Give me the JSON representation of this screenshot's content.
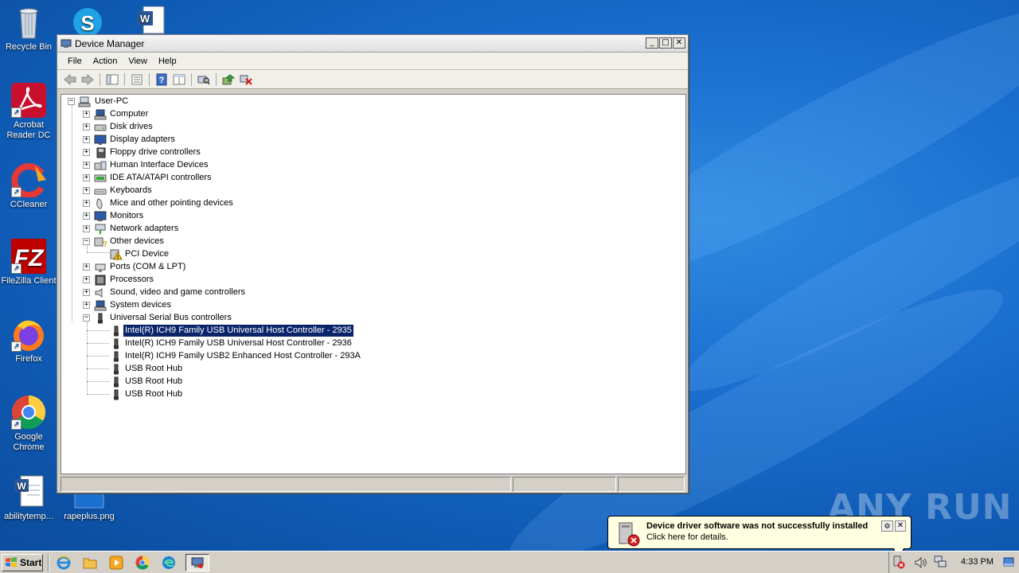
{
  "desktop": {
    "icons": [
      {
        "label": "Recycle Bin",
        "icon": "recycle-bin-icon"
      },
      {
        "label": "Acrobat Reader DC",
        "icon": "acrobat-icon"
      },
      {
        "label": "CCleaner",
        "icon": "ccleaner-icon"
      },
      {
        "label": "FileZilla Client",
        "icon": "filezilla-icon"
      },
      {
        "label": "Firefox",
        "icon": "firefox-icon"
      },
      {
        "label": "Google Chrome",
        "icon": "chrome-icon"
      },
      {
        "label": "abilitytemp...",
        "icon": "word-doc-icon"
      },
      {
        "label": "rapeplus.png",
        "icon": "image-file-icon"
      }
    ],
    "watermark": "ANY RUN"
  },
  "window": {
    "title": "Device Manager",
    "controls": {
      "minimize": "_",
      "maximize": "□",
      "close": "✕"
    },
    "menu": [
      "File",
      "Action",
      "View",
      "Help"
    ],
    "toolbar": [
      "back-icon",
      "forward-icon",
      "show-hide-console-tree-icon",
      "properties-icon",
      "help-icon",
      "action-pane-icon",
      "scan-hardware-icon",
      "update-driver-icon",
      "uninstall-icon"
    ]
  },
  "tree": {
    "root": "User-PC",
    "categories": [
      {
        "label": "Computer",
        "expanded": false
      },
      {
        "label": "Disk drives",
        "expanded": false
      },
      {
        "label": "Display adapters",
        "expanded": false
      },
      {
        "label": "Floppy drive controllers",
        "expanded": false
      },
      {
        "label": "Human Interface Devices",
        "expanded": false
      },
      {
        "label": "IDE ATA/ATAPI controllers",
        "expanded": false
      },
      {
        "label": "Keyboards",
        "expanded": false
      },
      {
        "label": "Mice and other pointing devices",
        "expanded": false
      },
      {
        "label": "Monitors",
        "expanded": false
      },
      {
        "label": "Network adapters",
        "expanded": false
      },
      {
        "label": "Other devices",
        "expanded": true,
        "children": [
          "PCI Device"
        ]
      },
      {
        "label": "Ports (COM & LPT)",
        "expanded": false
      },
      {
        "label": "Processors",
        "expanded": false
      },
      {
        "label": "Sound, video and game controllers",
        "expanded": false
      },
      {
        "label": "System devices",
        "expanded": false
      },
      {
        "label": "Universal Serial Bus controllers",
        "expanded": true,
        "children": [
          "Intel(R) ICH9 Family USB Universal Host Controller - 2935",
          "Intel(R) ICH9 Family USB Universal Host Controller - 2936",
          "Intel(R) ICH9 Family USB2 Enhanced Host Controller - 293A",
          "USB Root Hub",
          "USB Root Hub",
          "USB Root Hub"
        ]
      }
    ],
    "expand_symbol": "+",
    "collapse_symbol": "−",
    "selected": "Intel(R) ICH9 Family USB Universal Host Controller - 2935"
  },
  "balloon": {
    "title": "Device driver software was not successfully installed",
    "text": "Click here for details.",
    "close": "✕"
  },
  "taskbar": {
    "start_label": "Start",
    "quick_launch": [
      "ie-icon",
      "explorer-icon",
      "media-player-icon",
      "chrome-icon",
      "edge-icon"
    ],
    "active_task": "device-manager-task-icon",
    "clock": "4:33 PM"
  },
  "colors": {
    "selection": "#0a246a",
    "balloon_bg": "#ffffe1",
    "window_chrome": "#d4d0c8"
  }
}
